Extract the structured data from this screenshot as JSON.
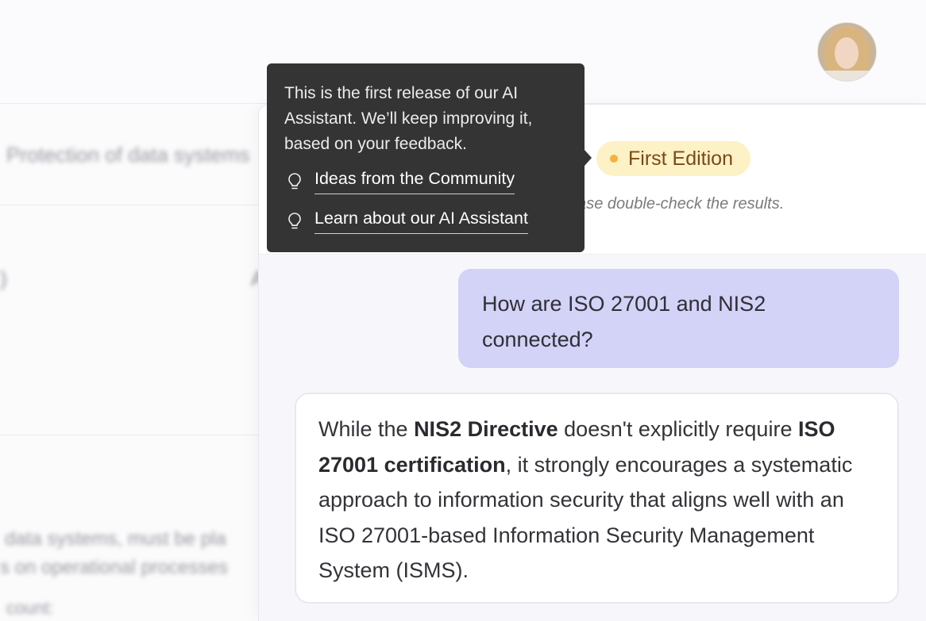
{
  "background": {
    "title": "Protection of data systems",
    "line1": "data systems, must be pla",
    "line2": "s on operational processes",
    "line3": "count:"
  },
  "tooltip": {
    "text": "This is the first release of our AI Assistant. We’ll keep improving it, based on your feedback.",
    "links": [
      {
        "label": "Ideas from the Community",
        "icon": "lightbulb-icon"
      },
      {
        "label": "Learn about our AI Assistant",
        "icon": "lightbulb-icon"
      }
    ]
  },
  "assistant": {
    "badge": "First Edition",
    "disclaimer": "ease double-check the results."
  },
  "chat": {
    "user_message": "How are ISO 27001 and NIS2 connected?",
    "ai_message": {
      "part1": "While the ",
      "bold1": "NIS2 Directive",
      "part2": " doesn't explicitly require ",
      "bold2": "ISO 27001 certification",
      "part3": ", it strongly encourages a systematic approach to information security that aligns well with an ISO 27001-based Information Security Management System (ISMS)."
    }
  },
  "colors": {
    "badge_bg": "#fdf1c6",
    "badge_dot": "#f5b23c",
    "user_bubble": "#d3d2f7",
    "tooltip_bg": "#343434"
  }
}
